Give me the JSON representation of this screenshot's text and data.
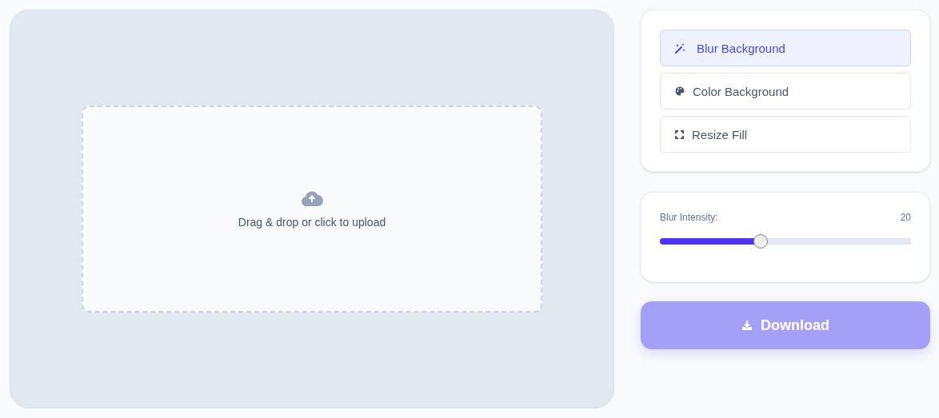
{
  "upload": {
    "prompt": "Drag & drop or click to upload"
  },
  "modes": [
    {
      "kind": "wand",
      "label": "Blur Background",
      "selected": true
    },
    {
      "kind": "palette",
      "label": "Color Background",
      "selected": false
    },
    {
      "kind": "expand",
      "label": "Resize Fill",
      "selected": false
    }
  ],
  "slider": {
    "label": "Blur Intensity:",
    "reading": "20",
    "level": 0.4
  },
  "download": {
    "label": "Download",
    "disabled": true
  }
}
